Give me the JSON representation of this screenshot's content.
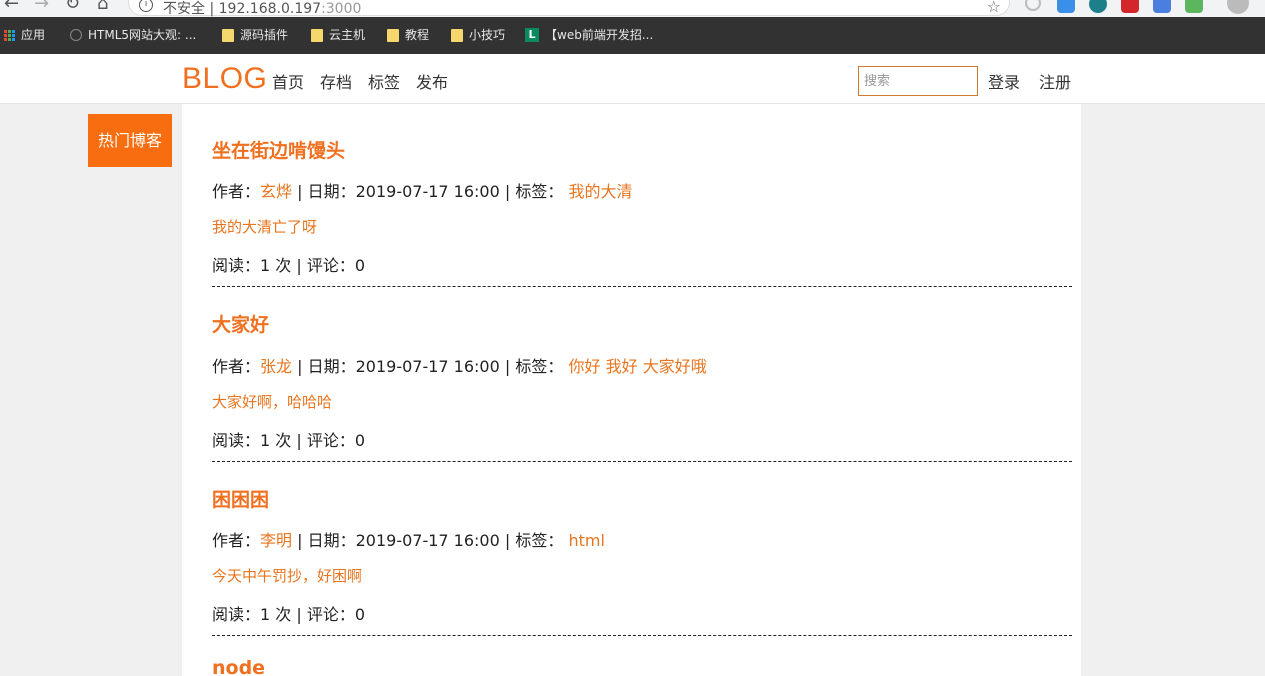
{
  "browser": {
    "address_prefix": "不安全 | ",
    "address_host": "192.168.0.197",
    "address_port": ":3000",
    "bookmarks": [
      "应用",
      "HTML5网站大观: ...",
      "源码插件",
      "云主机",
      "教程",
      "小技巧",
      "【web前端开发招..."
    ]
  },
  "site": {
    "logo": "BLOG",
    "nav": [
      "首页",
      "存档",
      "标签",
      "发布"
    ],
    "search_placeholder": "搜索",
    "login": "登录",
    "register": "注册"
  },
  "sidebar": {
    "hot_label": "热门博客"
  },
  "meta_labels": {
    "author": "作者：",
    "date": " | 日期：",
    "tags": " | 标签：",
    "reads": "阅读：",
    "times_sep": " 次 | 评论：",
    "tag_sep": " "
  },
  "posts": [
    {
      "title": "坐在街边啃馒头",
      "author": "玄烨",
      "date": "2019-07-17 16:00",
      "tags": [
        "我的大清"
      ],
      "excerpt": "我的大清亡了呀",
      "reads": "1",
      "comments": "0"
    },
    {
      "title": "大家好",
      "author": "张龙",
      "date": "2019-07-17 16:00",
      "tags": [
        "你好",
        "我好",
        "大家好哦"
      ],
      "excerpt": "大家好啊，哈哈哈",
      "reads": "1",
      "comments": "0"
    },
    {
      "title": "困困困",
      "author": "李明",
      "date": "2019-07-17 16:00",
      "tags": [
        "html"
      ],
      "excerpt": "今天中午罚抄，好困啊",
      "reads": "1",
      "comments": "0"
    },
    {
      "title": "node"
    }
  ]
}
